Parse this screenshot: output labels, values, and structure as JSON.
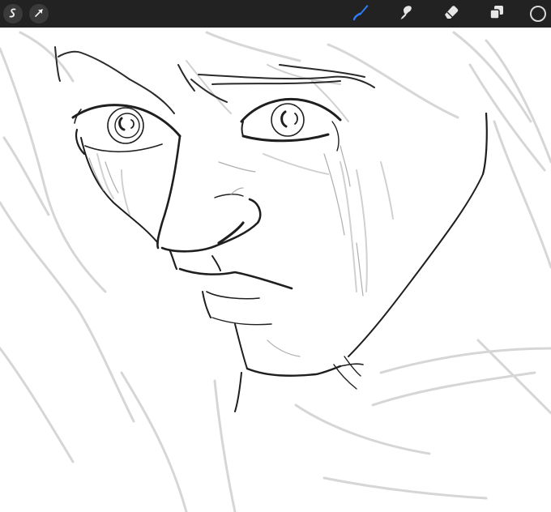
{
  "toolbar": {
    "left": [
      {
        "name": "gallery-icon"
      },
      {
        "name": "transform-arrow-icon"
      }
    ],
    "tools": [
      {
        "name": "brush-icon",
        "active": true
      },
      {
        "name": "smudge-icon",
        "active": false
      },
      {
        "name": "eraser-icon",
        "active": false
      },
      {
        "name": "layers-icon",
        "active": false
      }
    ],
    "color_swatch": "#222222"
  },
  "colors": {
    "toolbar_bg": "#222222",
    "active_tool": "#2f7cf6",
    "icon": "#e6e6e6",
    "canvas": "#ffffff"
  }
}
